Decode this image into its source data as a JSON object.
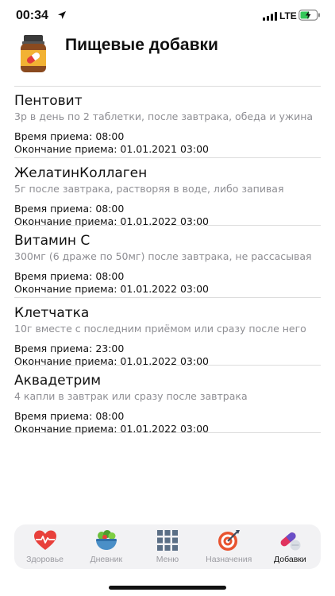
{
  "status": {
    "time": "00:34",
    "network": "LTE",
    "icons": [
      "location-arrow-icon",
      "signal-bars-icon",
      "battery-charging-icon"
    ]
  },
  "header": {
    "title": "Пищевые добавки",
    "icon": "supplement-bottle-icon"
  },
  "items": [
    {
      "name": "Пентовит",
      "description": "3р в день по 2 таблетки, после завтрака, обеда и ужина",
      "time_line": "Время приема: 08:00",
      "end_line": "Окончание приема: 01.01.2021 03:00"
    },
    {
      "name": "ЖелатинКоллаген",
      "description": "5г после завтрака, растворяя в воде, либо запивая",
      "time_line": "Время приема: 08:00",
      "end_line": "Окончание приема: 01.01.2022 03:00"
    },
    {
      "name": "Витамин С",
      "description": "300мг (6 драже по 50мг) после завтрака, не рассасывая",
      "time_line": "Время приема: 08:00",
      "end_line": "Окончание приема: 01.01.2022 03:00"
    },
    {
      "name": "Клетчатка",
      "description": "10г вместе с последним приёмом или сразу после него",
      "time_line": "Время приема: 23:00",
      "end_line": "Окончание приема: 01.01.2022 03:00"
    },
    {
      "name": "Аквадетрим",
      "description": "4 капли в завтрак или сразу после завтрака",
      "time_line": "Время приема: 08:00",
      "end_line": "Окончание приема: 01.01.2022 03:00"
    }
  ],
  "tabs": [
    {
      "label": "Здоровье",
      "icon": "heart-pulse-icon",
      "active": false
    },
    {
      "label": "Дневник",
      "icon": "food-bowl-icon",
      "active": false
    },
    {
      "label": "Меню",
      "icon": "grid-menu-icon",
      "active": false
    },
    {
      "label": "Назначения",
      "icon": "target-icon",
      "active": false
    },
    {
      "label": "Добавки",
      "icon": "pills-icon",
      "active": true
    }
  ],
  "colors": {
    "accent_active": "#111111",
    "tab_inactive": "#9a9aa0",
    "secondary_text": "#8e8e93",
    "heart": "#e8403b",
    "target": "#e8532f",
    "grid": "#5b6f86",
    "pill": "#e0335e"
  }
}
